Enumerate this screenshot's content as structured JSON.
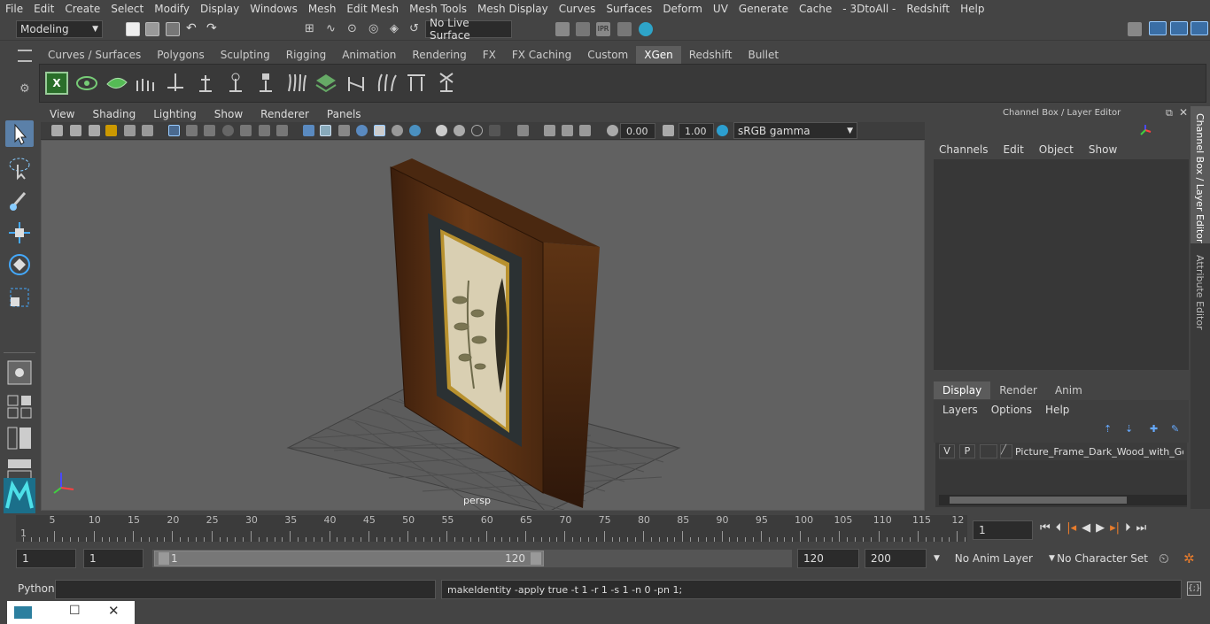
{
  "menu": [
    "File",
    "Edit",
    "Create",
    "Select",
    "Modify",
    "Display",
    "Windows",
    "Mesh",
    "Edit Mesh",
    "Mesh Tools",
    "Mesh Display",
    "Curves",
    "Surfaces",
    "Deform",
    "UV",
    "Generate",
    "Cache",
    "- 3DtoAll -",
    "Redshift",
    "Help"
  ],
  "status": {
    "mode": "Modeling",
    "live_surface": "No Live Surface"
  },
  "shelf_tabs": [
    "Curves / Surfaces",
    "Polygons",
    "Sculpting",
    "Rigging",
    "Animation",
    "Rendering",
    "FX",
    "FX Caching",
    "Custom",
    "XGen",
    "Redshift",
    "Bullet"
  ],
  "shelf_active": "XGen",
  "panel_menu": [
    "View",
    "Shading",
    "Lighting",
    "Show",
    "Renderer",
    "Panels"
  ],
  "panel_toolbar": {
    "exposure": "0.00",
    "gamma": "1.00",
    "color_space": "sRGB gamma"
  },
  "viewport": {
    "camera_label": "persp",
    "background": "#616161"
  },
  "channel_box": {
    "title": "Channel Box / Layer Editor",
    "menu": [
      "Channels",
      "Edit",
      "Object",
      "Show"
    ],
    "tabs": [
      "Display",
      "Render",
      "Anim"
    ],
    "active_tab": "Display",
    "layer_menu": [
      "Layers",
      "Options",
      "Help"
    ],
    "layer": {
      "v": "V",
      "p": "P",
      "name": "Picture_Frame_Dark_Wood_with_Gol"
    }
  },
  "side_tabs": [
    "Channel Box / Layer Editor",
    "Attribute Editor"
  ],
  "timeline": {
    "labels": [
      "1",
      "5",
      "10",
      "15",
      "20",
      "25",
      "30",
      "35",
      "40",
      "45",
      "50",
      "55",
      "60",
      "65",
      "70",
      "75",
      "80",
      "85",
      "90",
      "95",
      "100",
      "105",
      "110",
      "115",
      "12"
    ],
    "current_frame": "1"
  },
  "range": {
    "start": "1",
    "playback_start": "1",
    "slider_start": "1",
    "slider_end": "120",
    "end": "120",
    "anim_end": "200",
    "anim_layer": "No Anim Layer",
    "char_set": "No Character Set"
  },
  "cmd": {
    "lang": "Python",
    "output": "makeIdentity -apply true -t 1 -r 1 -s 1 -n 0 -pn 1;"
  }
}
